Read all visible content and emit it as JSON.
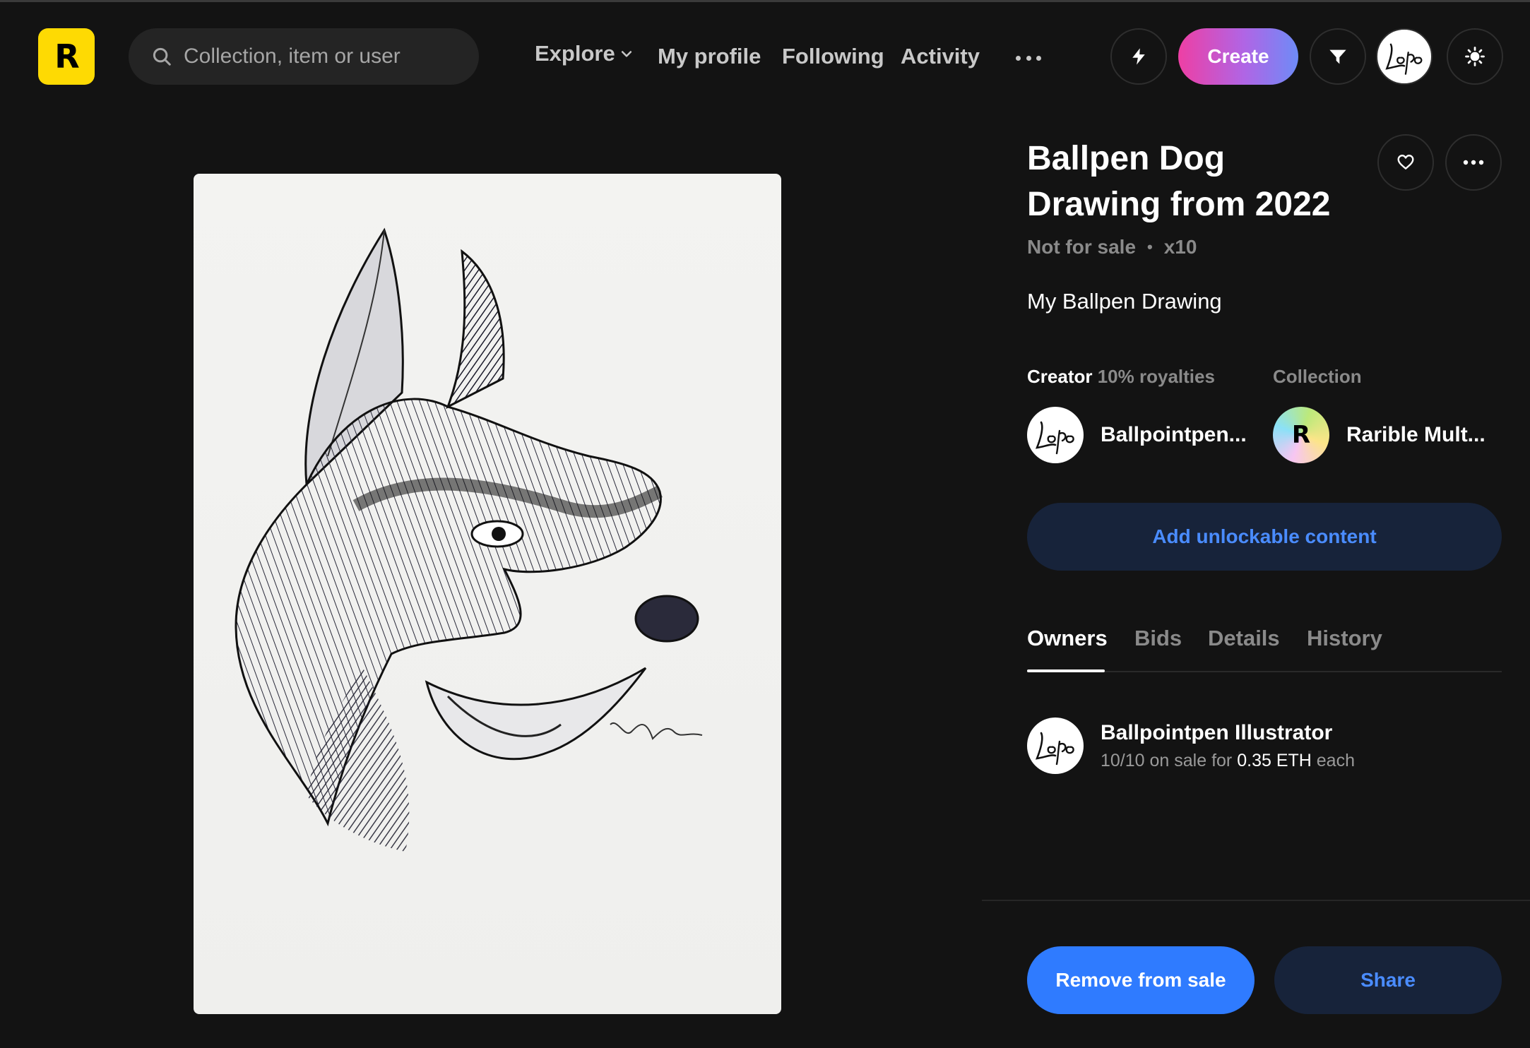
{
  "app": {
    "logo_letter": "R",
    "brand_color": "#FEDA03",
    "accent_blue": "#2F7BFF"
  },
  "header": {
    "search_placeholder": "Collection, item or user",
    "nav": {
      "explore": "Explore",
      "my_profile": "My profile",
      "following": "Following",
      "activity": "Activity"
    },
    "icons": [
      "search-icon",
      "chevron-down-icon",
      "more-dots-icon",
      "lightning-icon",
      "funnel-icon",
      "sun-icon"
    ],
    "create_label": "Create",
    "avatar_signature": "Lopo"
  },
  "item": {
    "title": "Ballpen Dog Drawing from 2022",
    "status": "Not for sale",
    "edition": "x10",
    "description": "My Ballpen Drawing",
    "artwork_signature": "Yola",
    "creator_label": "Creator",
    "royalties": "10% royalties",
    "collection_label": "Collection",
    "creator_name": "Ballpointpen...",
    "collection_name": "Rarible Mult...",
    "collection_avatar_letter": "R",
    "unlockable_label": "Add unlockable content"
  },
  "tabs": [
    "Owners",
    "Bids",
    "Details",
    "History"
  ],
  "active_tab": "Owners",
  "owners": [
    {
      "name": "Ballpointpen Illustrator",
      "quantity": "10/10",
      "on_sale_for": "on sale for",
      "price": "0.35 ETH",
      "each": "each",
      "avatar_signature": "Lopo"
    }
  ],
  "actions": {
    "remove": "Remove from sale",
    "share": "Share"
  }
}
